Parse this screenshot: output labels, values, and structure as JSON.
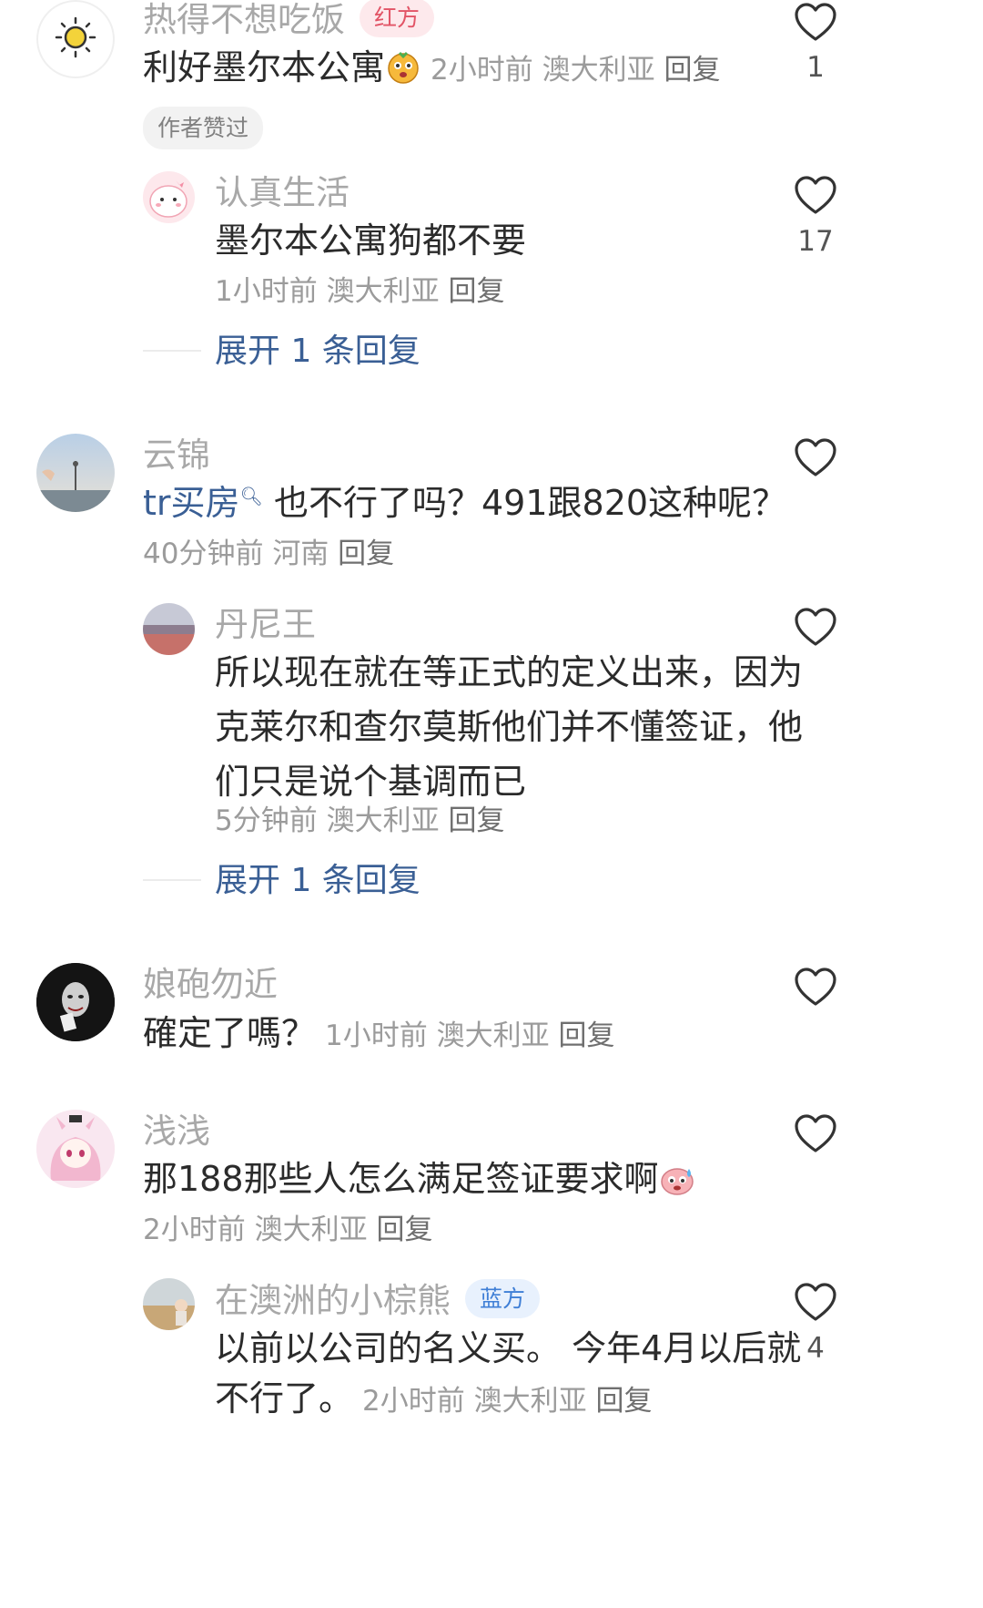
{
  "comments": [
    {
      "username": "热得不想吃饭",
      "badge": "红方",
      "text": "利好墨尔本公寓",
      "time": "2小时前",
      "location": "澳大利亚",
      "reply": "回复",
      "likes": "1",
      "author_liked": "作者赞过",
      "avatar": "sun-icon",
      "emoji": "dizzy-face-emoji"
    },
    {
      "username": "认真生活",
      "text": "墨尔本公寓狗都不要",
      "time": "1小时前",
      "location": "澳大利亚",
      "reply": "回复",
      "likes": "17",
      "avatar": "cartoon-avatar"
    },
    {
      "expand": "展开 1 条回复"
    },
    {
      "username": "云锦",
      "mention": "tr买房",
      "text": " 也不行了吗？491跟820这种呢？",
      "time": "40分钟前",
      "location": "河南",
      "reply": "回复",
      "avatar": "sky-photo"
    },
    {
      "username": "丹尼王",
      "text": "所以现在就在等正式的定义出来，因为克莱尔和查尔莫斯他们并不懂签证，他们只是说个基调而已",
      "time": "5分钟前",
      "location": "澳大利亚",
      "reply": "回复",
      "avatar": "sunset-photo"
    },
    {
      "expand": "展开 1 条回复"
    },
    {
      "username": "娘砲勿近",
      "text": "確定了嗎？",
      "time": "1小时前",
      "location": "澳大利亚",
      "reply": "回复",
      "avatar": "joker-photo"
    },
    {
      "username": "浅浅",
      "text": "那188那些人怎么满足签证要求啊",
      "time": "2小时前",
      "location": "澳大利亚",
      "reply": "回复",
      "avatar": "anime-girl",
      "emoji": "sweat-emoji"
    },
    {
      "username": "在澳洲的小棕熊",
      "badge": "蓝方",
      "text_line1": "以前以公司的名义买。 今年4月以后就",
      "text_line2": "不行了。",
      "time": "2小时前",
      "location": "澳大利亚",
      "reply": "回复",
      "likes": "4",
      "avatar": "beach-photo"
    }
  ],
  "colors": {
    "accent_blue": "#3a5f95",
    "badge_red": "#e25466",
    "badge_blue": "#3f7fd6",
    "meta_gray": "#9b9b9b"
  }
}
